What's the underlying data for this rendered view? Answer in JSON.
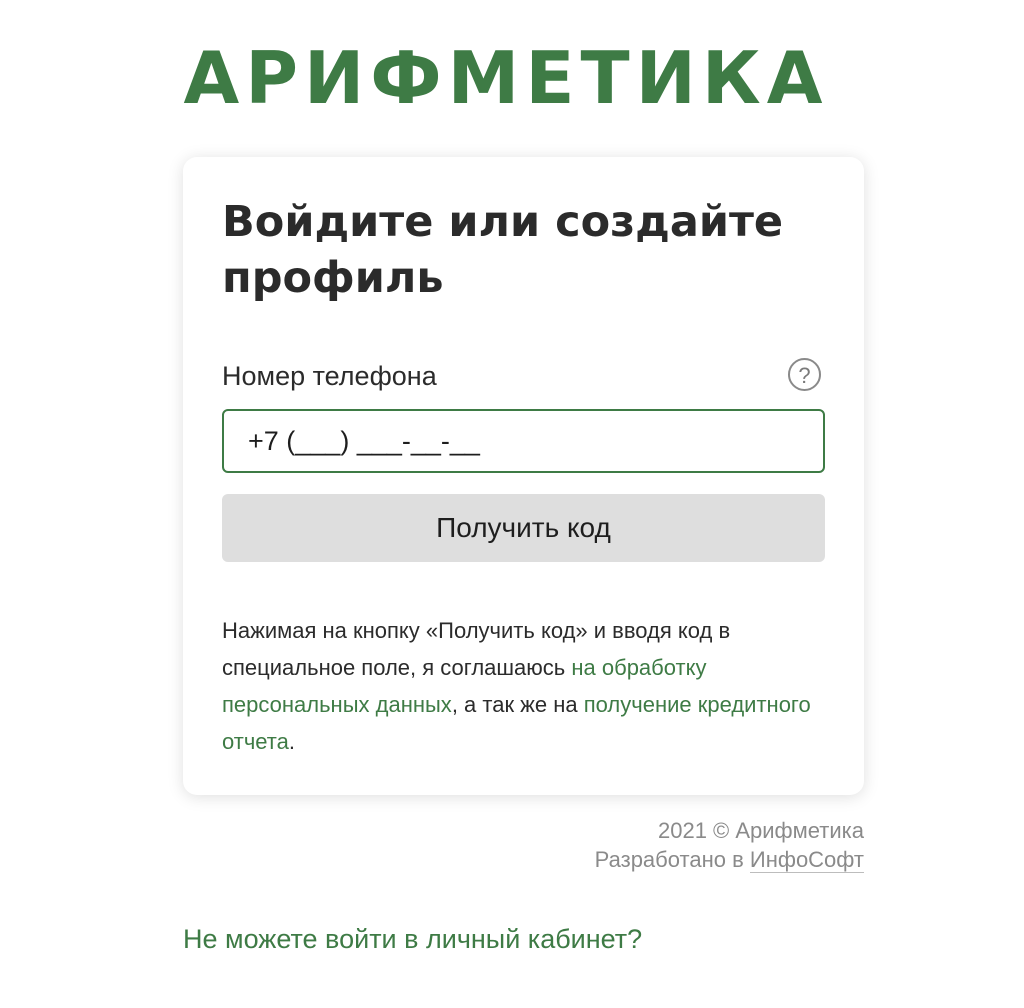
{
  "logo": {
    "text": "АРИФМЕТИКА"
  },
  "login_card": {
    "title": "Войдите или создайте профиль",
    "phone_label": "Номер телефона",
    "help_icon": "question-circle-icon",
    "help_symbol": "?",
    "phone_placeholder": "+7 (___) ___-__-__",
    "phone_value": "",
    "submit_label": "Получить код",
    "consent": {
      "text_1": "Нажимая на кнопку «Получить код» и вводя код в специальное поле, я соглашаюсь ",
      "link_1": "на обработку персональных данных",
      "text_2": ", а так же на ",
      "link_2": "получение кредитного отчета",
      "text_3": "."
    }
  },
  "footer": {
    "copyright": "2021 © Арифметика",
    "developed_by_prefix": "Разработано в ",
    "developer_link": "ИнфоСофт",
    "cant_login_link": "Не можете войти в личный кабинет?"
  },
  "colors": {
    "brand_green": "#3e7b45",
    "button_gray": "#dedede",
    "muted_text": "#8a8a8a"
  }
}
